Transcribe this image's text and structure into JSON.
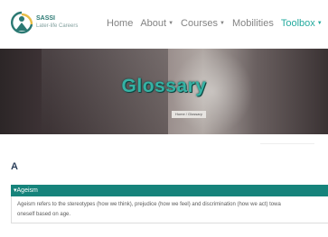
{
  "brand": {
    "name": "SASSI",
    "tagline": "Later-life Careers",
    "logo_icon": "person-circle-logo-icon"
  },
  "nav": {
    "items": [
      {
        "label": "Home",
        "has_dropdown": false
      },
      {
        "label": "About",
        "has_dropdown": true
      },
      {
        "label": "Courses",
        "has_dropdown": true
      },
      {
        "label": "Mobilities",
        "has_dropdown": false
      },
      {
        "label": "Toolbox",
        "has_dropdown": true,
        "active": true
      }
    ],
    "caret_icon": "chevron-down-icon"
  },
  "hero": {
    "title": "Glossary",
    "breadcrumb": [
      "Home",
      "/",
      "Glossary"
    ]
  },
  "glossary": {
    "section_letter": "A",
    "entries": [
      {
        "term": "Ageism",
        "expanded": true,
        "definition_line1": "Ageism refers to the stereotypes (how we think), prejudice (how we feel) and discrimination (how we act) towa",
        "definition_line2": "oneself based on age."
      }
    ]
  },
  "colors": {
    "accent": "#16837b",
    "active_nav": "#16a598",
    "hero_title": "#35b2a4",
    "heading": "#2b3f5a"
  }
}
